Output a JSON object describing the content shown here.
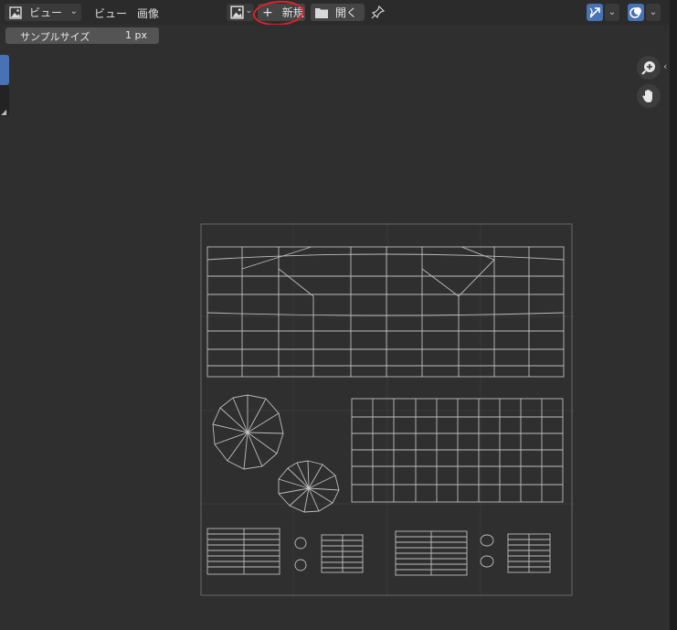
{
  "header": {
    "editor_type_label": "ビュー",
    "menus": [
      "ビュー",
      "画像"
    ],
    "new_button": "新規",
    "open_button": "開く"
  },
  "toolbar": {
    "sample_size_label": "サンプルサイズ",
    "sample_size_value": "1 px"
  },
  "icons": {
    "editor_type": "image-editor-icon",
    "image_type": "image-icon",
    "new": "plus-icon",
    "open": "folder-icon",
    "pin": "pin-icon",
    "gizmo": "gizmo-icon",
    "overlay": "overlay-icon",
    "zoom": "zoom-icon",
    "pan": "hand-icon"
  },
  "colors": {
    "accent": "#4772b3",
    "annotation": "#e0202a",
    "uv_lines": "#bdbdbd"
  }
}
